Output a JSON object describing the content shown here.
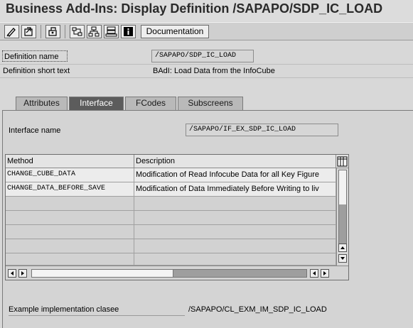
{
  "window": {
    "title": "Business Add-Ins: Display Definition /SAPAPO/SDP_IC_LOAD"
  },
  "toolbar": {
    "icons": [
      "edit-icon",
      "display-change-icon",
      "other-object-icon",
      "where-used-icon",
      "hierarchy-icon",
      "layout-icon",
      "info-icon"
    ],
    "documentation_label": "Documentation"
  },
  "header": {
    "definition_name_label": "Definition name",
    "definition_name_value": "/SAPAPO/SDP_IC_LOAD",
    "short_text_label": "Definition short text",
    "short_text_value": "BAdI: Load Data from the InfoCube"
  },
  "tabs": [
    {
      "label": "Attributes",
      "active": false
    },
    {
      "label": "Interface",
      "active": true
    },
    {
      "label": "FCodes",
      "active": false
    },
    {
      "label": "Subscreens",
      "active": false
    }
  ],
  "interface": {
    "name_label": "Interface name",
    "name_value": "/SAPAPO/IF_EX_SDP_IC_LOAD"
  },
  "methods_table": {
    "columns": [
      "Method",
      "Description"
    ],
    "rows": [
      {
        "method": "CHANGE_CUBE_DATA",
        "description": "Modification of Read Infocube Data for all Key Figure"
      },
      {
        "method": "CHANGE_DATA_BEFORE_SAVE",
        "description": "Modification of Data Immediately Before Writing to liv"
      }
    ]
  },
  "example": {
    "label": "Example implementation clasee",
    "value": "/SAPAPO/CL_EXM_IM_SDP_IC_LOAD"
  }
}
